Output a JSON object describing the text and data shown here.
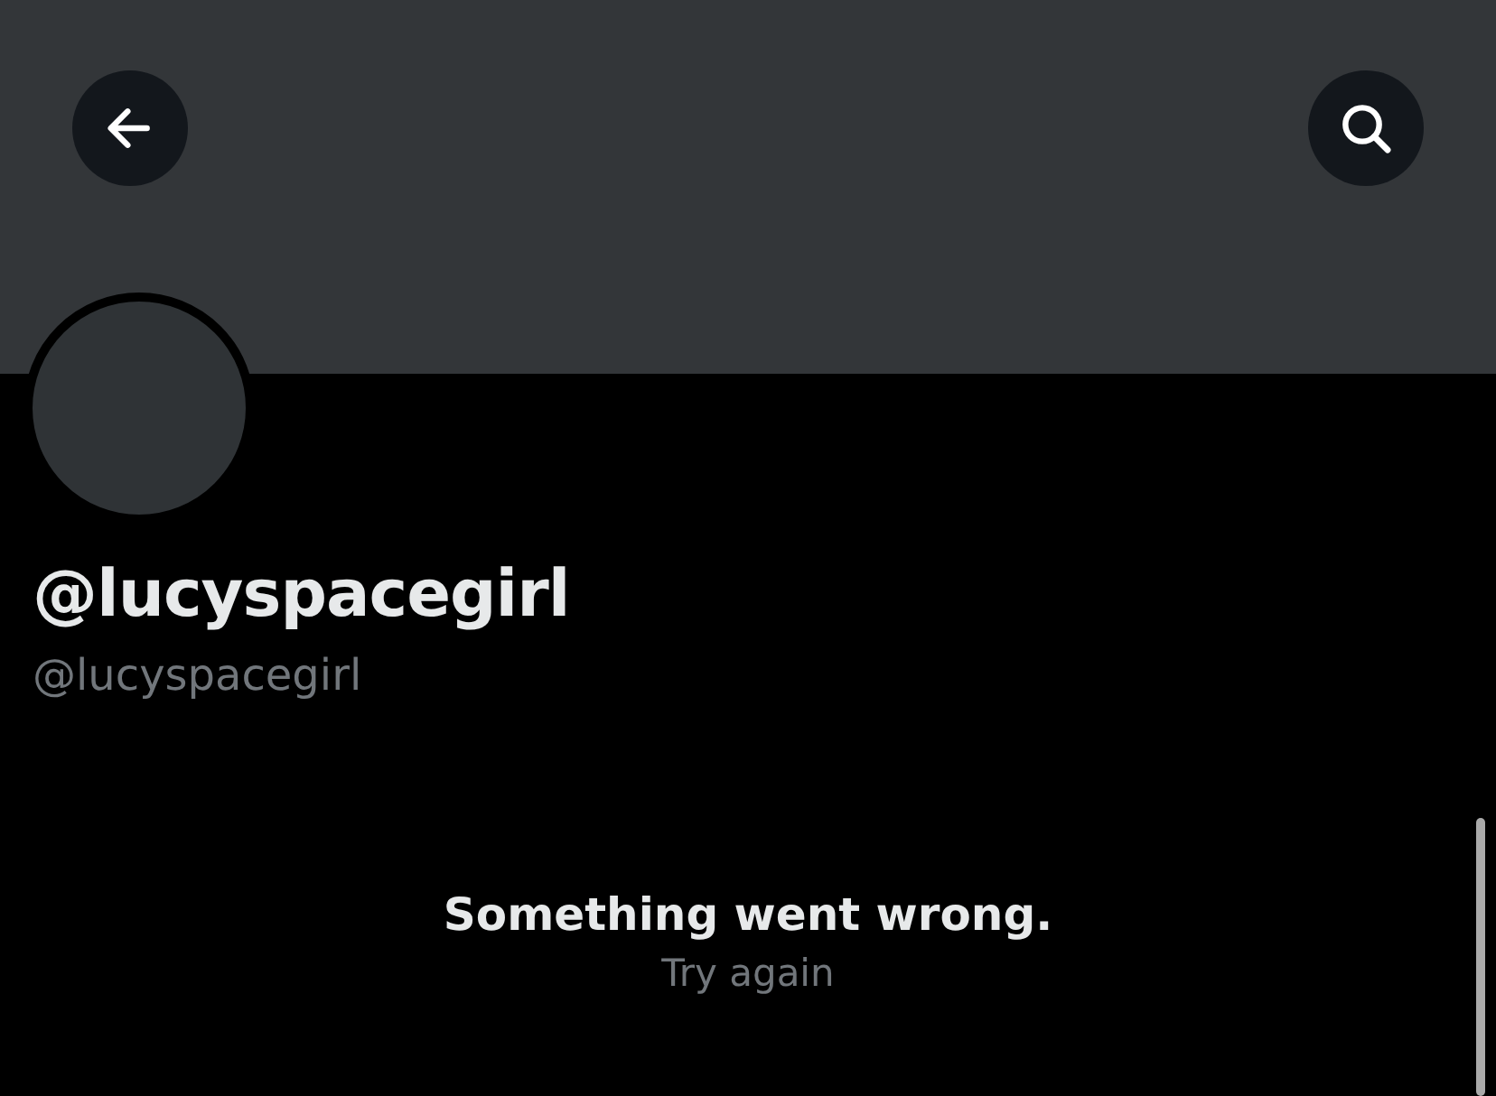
{
  "profile": {
    "display_name": "@lucyspacegirl",
    "handle": "@lucyspacegirl"
  },
  "error": {
    "message": "Something went wrong.",
    "retry": "Try again"
  }
}
